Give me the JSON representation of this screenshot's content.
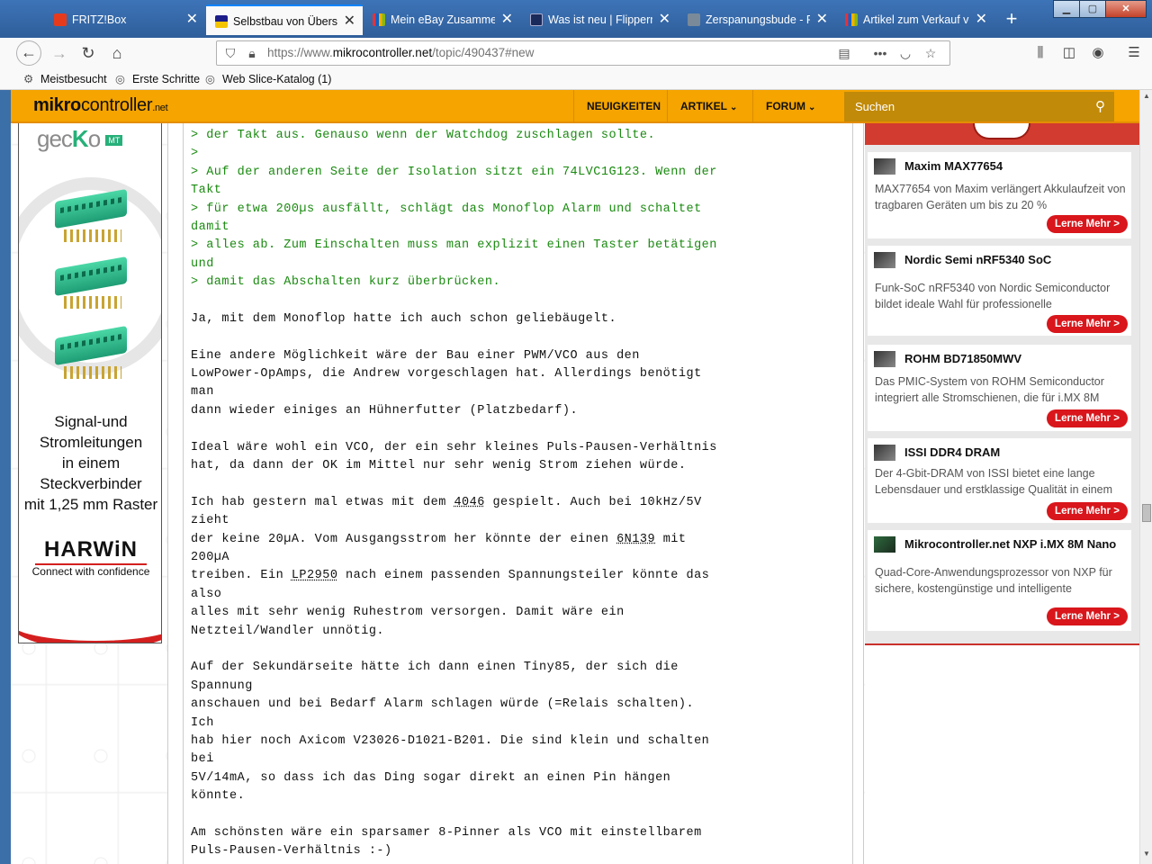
{
  "browser": {
    "tabs": [
      {
        "title": "FRITZ!Box",
        "active": false
      },
      {
        "title": "Selbstbau von Überspannungsschutz",
        "active": true
      },
      {
        "title": "Mein eBay Zusammenfassung",
        "active": false
      },
      {
        "title": "Was ist neu | Flippermarkt",
        "active": false
      },
      {
        "title": "Zerspanungsbude - Forum",
        "active": false
      },
      {
        "title": "Artikel zum Verkauf von",
        "active": false
      }
    ],
    "url_prefix": "https://www.",
    "url_domain": "mikrocontroller.net",
    "url_path": "/topic/490437#new",
    "bookmarks": [
      "Meistbesucht",
      "Erste Schritte",
      "Web Slice-Katalog (1)"
    ]
  },
  "site": {
    "logo_bold": "mikro",
    "logo_rest": "controller",
    "logo_tld": ".net",
    "nav": [
      {
        "label": "NEUIGKEITEN",
        "dropdown": false
      },
      {
        "label": "ARTIKEL",
        "dropdown": true
      },
      {
        "label": "FORUM",
        "dropdown": true
      }
    ],
    "search_placeholder": "Suchen"
  },
  "banner": {
    "brand_left": "gec",
    "brand_k": "K",
    "brand_o": "o",
    "brand_mt": "MT",
    "text_lines": [
      "Signal-und",
      "Stromleitungen",
      "in einem",
      "Steckverbinder",
      "mit 1,25 mm Raster"
    ],
    "logo": "HARWiN",
    "tagline": "Connect with confidence"
  },
  "post": {
    "lines": [
      {
        "text": "> der Takt aus. Genauso wenn der Watchdog zuschlagen sollte.",
        "quote": true
      },
      {
        "text": ">",
        "quote": true
      },
      {
        "text": "> Auf der anderen Seite der Isolation sitzt ein 74LVC1G123. Wenn der",
        "quote": true
      },
      {
        "text": "Takt",
        "quote": true
      },
      {
        "text": "> für etwa 200µs ausfällt, schlägt das Monoflop Alarm und schaltet",
        "quote": true
      },
      {
        "text": "damit",
        "quote": true
      },
      {
        "text": "> alles ab. Zum Einschalten muss man explizit einen Taster betätigen",
        "quote": true
      },
      {
        "text": "und",
        "quote": true
      },
      {
        "text": "> damit das Abschalten kurz überbrücken.",
        "quote": true
      },
      {
        "text": "",
        "quote": false
      },
      {
        "text": "Ja, mit dem Monoflop hatte ich auch schon geliebäugelt.",
        "quote": false
      },
      {
        "text": "",
        "quote": false
      },
      {
        "text": "Eine andere Möglichkeit wäre der Bau einer PWM/VCO aus den",
        "quote": false
      },
      {
        "text": "LowPower-OpAmps, die Andrew vorgeschlagen hat. Allerdings benötigt",
        "quote": false
      },
      {
        "text": "man",
        "quote": false
      },
      {
        "text": "dann wieder einiges an Hühnerfutter (Platzbedarf).",
        "quote": false
      },
      {
        "text": "",
        "quote": false
      },
      {
        "text": "Ideal wäre wohl ein VCO, der ein sehr kleines Puls-Pausen-Verhältnis",
        "quote": false
      },
      {
        "text": "hat, da dann der OK im Mittel nur sehr wenig Strom ziehen würde.",
        "quote": false
      },
      {
        "text": "",
        "quote": false
      },
      {
        "text": "Ich hab gestern mal etwas mit dem 4046 gespielt. Auch bei 10kHz/5V",
        "quote": false,
        "link": "4046"
      },
      {
        "text": "zieht",
        "quote": false
      },
      {
        "text": "der keine 20µA. Vom Ausgangsstrom her könnte der einen 6N139 mit",
        "quote": false,
        "link": "6N139"
      },
      {
        "text": "200µA",
        "quote": false
      },
      {
        "text": "treiben. Ein LP2950 nach einem passenden Spannungsteiler könnte das",
        "quote": false,
        "link": "LP2950"
      },
      {
        "text": "also",
        "quote": false
      },
      {
        "text": "alles mit sehr wenig Ruhestrom versorgen. Damit wäre ein",
        "quote": false
      },
      {
        "text": "Netzteil/Wandler unnötig.",
        "quote": false
      },
      {
        "text": "",
        "quote": false
      },
      {
        "text": "Auf der Sekundärseite hätte ich dann einen Tiny85, der sich die",
        "quote": false
      },
      {
        "text": "Spannung",
        "quote": false
      },
      {
        "text": "anschauen und bei Bedarf Alarm schlagen würde (=Relais schalten).",
        "quote": false
      },
      {
        "text": "Ich",
        "quote": false
      },
      {
        "text": "hab hier noch Axicom V23026-D1021-B201. Die sind klein und schalten",
        "quote": false
      },
      {
        "text": "bei",
        "quote": false
      },
      {
        "text": "5V/14mA, so dass ich das Ding sogar direkt an einen Pin hängen",
        "quote": false
      },
      {
        "text": "könnte.",
        "quote": false
      },
      {
        "text": "",
        "quote": false
      },
      {
        "text": "Am schönsten wäre ein sparsamer 8-Pinner als VCO mit einstellbarem",
        "quote": false
      },
      {
        "text": "Puls-Pausen-Verhältnis :-)",
        "quote": false
      }
    ]
  },
  "sidebar": {
    "button_label": "Lerne Mehr >",
    "cards": [
      {
        "title": "Maxim MAX77654",
        "desc": "MAX77654 von Maxim verlängert Akkulaufzeit von tragbaren Geräten um bis zu 20 %"
      },
      {
        "title": "Nordic Semi nRF5340 SoC",
        "desc": "Funk-SoC nRF5340 von Nordic Semiconductor bildet ideale Wahl für professionelle"
      },
      {
        "title": "ROHM BD71850MWV",
        "desc": "Das PMIC-System von ROHM Semiconductor integriert alle Stromschienen, die für i.MX 8M"
      },
      {
        "title": "ISSI DDR4 DRAM",
        "desc": "Der 4-Gbit-DRAM von ISSI bietet eine lange Lebensdauer und erstklassige Qualität in einem"
      },
      {
        "title": "Mikrocontroller.net NXP i.MX 8M Nano",
        "desc": "Quad-Core-Anwendungsprozessor von NXP für sichere, kostengünstige und intelligente"
      }
    ]
  },
  "colors": {
    "header_orange": "#f5a400",
    "quote_green": "#1a8a10",
    "button_red": "#d8161b"
  }
}
